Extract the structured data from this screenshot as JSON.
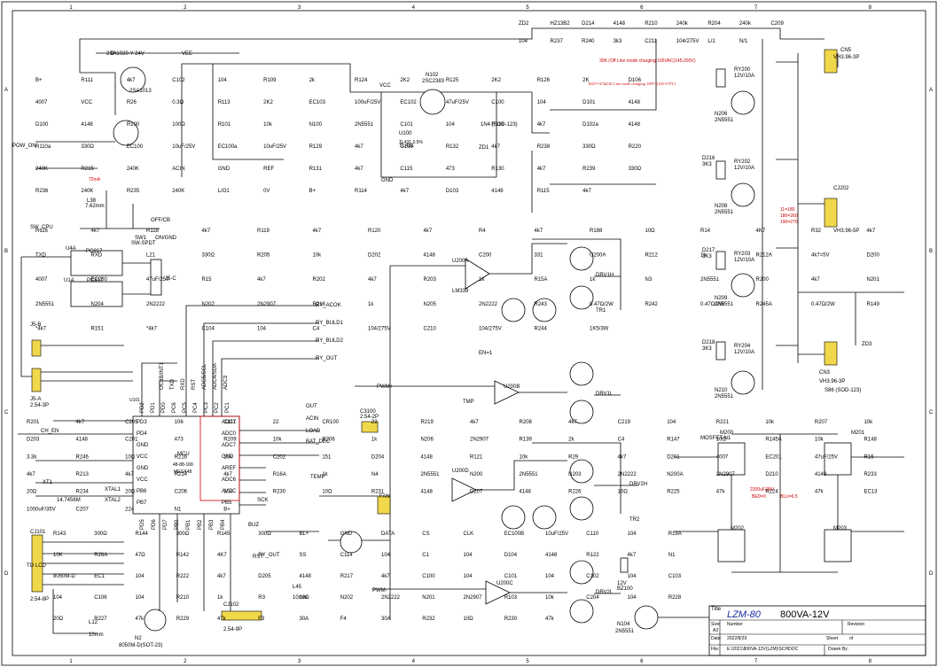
{
  "frame": {
    "columns": [
      "1",
      "2",
      "3",
      "4",
      "5",
      "6",
      "7",
      "8"
    ],
    "rows": [
      "A",
      "B",
      "C",
      "D"
    ]
  },
  "title_block": {
    "title_label": "Title",
    "title": "LZM-80",
    "subtitle": "800VA-12V",
    "size_label": "Size",
    "size": "A3",
    "number_label": "Number",
    "revision_label": "Revision",
    "date_label": "Date:",
    "date": "2022/8/29",
    "file_label": "File:",
    "file": "E:\\2021\\800VA-12V(LZM)\\SCHDOC",
    "sheet_label": "Sheet",
    "sheet_of": "of",
    "drawn_label": "Drawn By:"
  },
  "mcu": {
    "name": "MCU",
    "part": "48-88-168",
    "model": "MEGA48",
    "ref": "U101",
    "left_pins": [
      "PD3",
      "PD4",
      "GND",
      "VCC",
      "GND",
      "VCC",
      "PB6",
      "PB7"
    ],
    "top_pins": [
      "PD2",
      "PD1",
      "PD0",
      "PC6",
      "PC5",
      "PC4",
      "PC3",
      "PC2",
      "PC1"
    ],
    "top_pin_labels": [
      "OC3B/INT1",
      "TXD",
      "RXD",
      "RST",
      "ADC5/SCL",
      "ADC4/SDA",
      "ADC3"
    ],
    "right_pins": [
      "ADC1",
      "ADC0",
      "ADC7",
      "GND",
      "AREF",
      "ADC6",
      "AVCC",
      "PB5"
    ],
    "bottom_pins": [
      "PD5",
      "PD6",
      "PD7",
      "PB0",
      "PB1",
      "PB2",
      "PB3",
      "PB4"
    ],
    "xtal_labels": [
      "XTAL1",
      "XTAL2"
    ]
  },
  "nets": {
    "out": "OUT",
    "acin": "ACIN",
    "load": "LOAD",
    "bat_dec": "BAT_DEC",
    "temp": "TEMP",
    "buz": "BUZ",
    "sck": "SCK",
    "rst": "RST",
    "pow_on": "POW_ON",
    "sw_cpu": "SW_CPU",
    "ch_en": "CH_EN",
    "ry_acok": "RY_ACOK",
    "ry_buld1": "RY_BULD1",
    "ry_buld2": "RY_BULD2",
    "ry_out": "RY_OUT",
    "drv1h": "DRV1H",
    "drv1l": "DRV1L",
    "drv2h": "DRV2H",
    "drv2l": "DRV2L",
    "pwm_plus": "PWM+",
    "pwm_minus": "PWM-",
    "tmp": "TMP",
    "tr1": "TR1",
    "tr2": "TR2",
    "vcc": "VCC",
    "gnd": "GND",
    "bplus": "B+",
    "vee": "VEE",
    "fan": "FAN",
    "en1": "EN=1",
    "off_cb": "OFF/CB",
    "on_gnd": "ON/GND"
  },
  "notes": {
    "charging1": "30K (Off Line mode charging 165VAC(145-290V)",
    "charging2": "R237=27k(Off Line mode charging 180V)(165-275V)",
    "zd1": "TL431 0.5%",
    "current": "72mA",
    "pins_note": "11=180",
    "pins_note2": "180=260",
    "pins_note3": "190=270",
    "bled": "BED=0",
    "bleu": "BLU=6.5",
    "cap_note": "2200uF/35V"
  },
  "parts": {
    "q_top": "2SA1020-Y-24V",
    "q_top2": "2SA1013",
    "n102": "N102",
    "n102p": "2SC2383",
    "u100": "U100",
    "tl431": "TL431",
    "zd1": "ZD1",
    "ss12": "1N4 (SOD-123)",
    "pc817a": "PC817",
    "pc817b": "PC817",
    "u4a": "U4A",
    "u1a": "U1A",
    "j5c": "J5-C",
    "j5b": "J5-B",
    "j5a": "J5-A",
    "j5a_type": "2.54-3P",
    "cj101": "CJ101",
    "cj101_type": "2.54-8P",
    "to_lcd": "TO LCD",
    "cj102": "CJ102",
    "cj102_type": "2.54-9P",
    "cn5": "CN5",
    "cn5_type": "VH3.96-3P",
    "cj202": "CJ202",
    "cj202_type": "VH3.96-5P",
    "cn3": "CN3",
    "cn3_type": "VH3.96-3P",
    "c3100": "C3100",
    "c3100_type": "2.54-2P",
    "lm339": "LM339",
    "u200a": "U200A",
    "u200b": "U200B",
    "u200c": "U200C",
    "u200d": "U200D",
    "m200": "M200",
    "m201": "M201",
    "m202": "M202",
    "m203": "M203",
    "mosfet": "MOSFET-N1",
    "n2": "N2",
    "n2p": "8050M-D(SOT-23)",
    "n104": "N104",
    "n104p": "2N5551",
    "bz100": "BZ100",
    "bz_v": "12V",
    "zd3": "ZD3",
    "zd3p": "S86 (SOD-123)",
    "sw1": "SW1",
    "sw1p": "SW-SPDT",
    "xt1": "XT1",
    "xtal": "14.7456M",
    "l38": "L38",
    "l38v": "7.62mm",
    "l12": "L12",
    "l12v": "10mm",
    "l45": "L45",
    "l45v": "10mm"
  },
  "relays": [
    {
      "ref": "RY200",
      "rating": "12V/10A",
      "q": "N206",
      "qp": "2N5551",
      "d": "D216",
      "dv": "3K3"
    },
    {
      "ref": "RY202",
      "rating": "12V/10A",
      "q": "N208",
      "qp": "2N5551",
      "d": "D217",
      "dv": "3K3"
    },
    {
      "ref": "RY203",
      "rating": "12V/10A",
      "q": "N209",
      "qp": "2N5551",
      "d": "D218",
      "dv": "3K3"
    },
    {
      "ref": "RY204",
      "rating": "12V/10A",
      "q": "N210",
      "qp": "2N5551",
      "d": "",
      "dv": ""
    }
  ],
  "labels_top": [
    "ZD2",
    "HZ13B2",
    "D214",
    "4148",
    "R210",
    "240k",
    "R204",
    "240k",
    "C209",
    "104",
    "R237",
    "R240",
    "3k3",
    "C211",
    "104/275V",
    "L/1",
    "N/1"
  ],
  "labels_a": [
    "B+",
    "R111",
    "4k7",
    "C102",
    "104",
    "R109",
    "2k",
    "R124",
    "2K2",
    "R125",
    "2K2",
    "R126",
    "2K",
    "D106",
    "4007",
    "VCC",
    "R26",
    "0.3Ω",
    "R113",
    "2K2",
    "EC103",
    "100uF/25V",
    "EC102",
    "47uF/25V",
    "C100",
    "104",
    "D101",
    "4148",
    "D100",
    "4148",
    "R100",
    "100Ω",
    "R101",
    "10k",
    "N100",
    "2N5551",
    "C101",
    "104",
    "R110",
    "4k7",
    "D102a",
    "4148",
    "R110a",
    "330Ω",
    "EC100",
    "10uF/25V",
    "EC100a",
    "10uF/25V",
    "R129",
    "4k7",
    "C136",
    "R132",
    "4k7",
    "R238",
    "330Ω",
    "R220",
    "240K",
    "R215",
    "240K",
    "ACIN",
    "GND",
    "REF",
    "R131",
    "4k7",
    "C115",
    "473",
    "R130",
    "4k7",
    "R239",
    "330Ω",
    "R236",
    "240K",
    "R235",
    "240K",
    "L/O1",
    "0V",
    "B+",
    "R114",
    "4k7",
    "D103",
    "4148",
    "R115",
    "4k7"
  ],
  "labels_b": [
    "R116",
    "4k7",
    "R118",
    "4k7",
    "R119",
    "4k7",
    "R120",
    "4k7",
    "R4",
    "4k7",
    "R188",
    "10Ω",
    "R14",
    "4K7",
    "R32",
    "4k7",
    "TXD",
    "RXD",
    "L21",
    "330Ω",
    "R205",
    "10k",
    "D202",
    "4148",
    "C200",
    "331",
    "U200A",
    "R212",
    "1k",
    "R212A",
    "4k7=5V",
    "D200",
    "4007",
    "EC200",
    "47uF/25V",
    "R15",
    "4k7",
    "R202",
    "4k7",
    "R203",
    "1k",
    "R15A",
    "1k",
    "N3",
    "2N5551",
    "R200",
    "4k7",
    "N201",
    "2N5551",
    "N204",
    "2N2222",
    "N202",
    "2N2907",
    "R218",
    "1k",
    "N205",
    "2N2222",
    "R243",
    "0.47Ω/2W",
    "R242",
    "0.47Ω/2W",
    "R245A",
    "0.47Ω/2W",
    "R149",
    "*4k7",
    "R151",
    "*4k7",
    "C104",
    "104",
    "C4",
    "104/275V",
    "C210",
    "104/275V",
    "R244",
    "1K5/3W"
  ],
  "labels_c": [
    "R201",
    "4k7",
    "C205",
    "106",
    "C117",
    "22",
    "CR100",
    "22",
    "R219",
    "4k7",
    "R208",
    "4k7",
    "C219",
    "104",
    "R221",
    "10k",
    "R207",
    "10k",
    "D203",
    "4148",
    "C201",
    "473",
    "R209",
    "10k",
    "R206",
    "1k",
    "N206",
    "2N2907",
    "R139",
    "2k",
    "C4",
    "R147",
    "10Ω",
    "R145A",
    "10k",
    "R148",
    "3.3k",
    "R246",
    "10Ω",
    "R216",
    "10k",
    "C202",
    "151",
    "D204",
    "4148",
    "R121",
    "10k",
    "R29",
    "4k7",
    "D201",
    "4007",
    "EC201",
    "47uF/25V",
    "R16",
    "4k7",
    "R213",
    "4k7",
    "R214",
    "4k7",
    "R16A",
    "1k",
    "N4",
    "2N5551",
    "N200",
    "2N5551",
    "N203",
    "2N2222",
    "N200A",
    "2N2907",
    "D210",
    "4148",
    "R233",
    "20Ω",
    "R234",
    "20Ω",
    "C206",
    "104",
    "R230",
    "10Ω",
    "R231",
    "4148",
    "D207",
    "4148",
    "R226",
    "10Ω",
    "R225",
    "47k",
    "R224",
    "47k",
    "EC13",
    "1000uF/35V",
    "C207",
    "224",
    "N1",
    "B+"
  ],
  "labels_d": [
    "R143",
    "300Ω",
    "R144",
    "300Ω",
    "R145",
    "300Ω",
    "BL+",
    "GND",
    "DATA",
    "CS",
    "CLK",
    "EC100B",
    "10uF/25V",
    "C110",
    "104",
    "R19A",
    "10K",
    "R26A",
    "47Ω",
    "R142",
    "4K7",
    "RY_OUT",
    "SS",
    "C114",
    "104",
    "C1",
    "104",
    "D104",
    "4148",
    "R122",
    "4k7",
    "N1",
    "8050M-D",
    "EC1",
    "104",
    "R222",
    "4k7",
    "D205",
    "4148",
    "R217",
    "4k7",
    "C100",
    "104",
    "C101",
    "104",
    "C102",
    "104",
    "C103",
    "104",
    "C106",
    "104",
    "R210",
    "1k",
    "R3",
    "10Ω",
    "N202",
    "2N2222",
    "N201",
    "2N2907",
    "R103",
    "10k",
    "C204",
    "104",
    "R228",
    "20Ω",
    "R227",
    "47k",
    "R229",
    "47k",
    "F3",
    "30A",
    "F4",
    "30A",
    "R232",
    "10Ω",
    "R230",
    "47k"
  ]
}
